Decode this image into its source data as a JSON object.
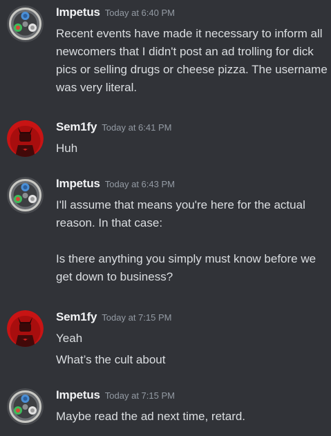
{
  "messages": [
    {
      "author": "Impetus",
      "avatar_icon": "compass-emblem-avatar",
      "timestamp": "Today at 6:40 PM",
      "lines": [
        "Recent events have made it necessary to inform all newcomers that I didn't post an ad trolling for dick pics or selling drugs or cheese pizza. The username was very literal."
      ]
    },
    {
      "author": "Sem1fy",
      "avatar_icon": "batman-red-avatar",
      "timestamp": "Today at 6:41 PM",
      "lines": [
        "Huh"
      ]
    },
    {
      "author": "Impetus",
      "avatar_icon": "compass-emblem-avatar",
      "timestamp": "Today at 6:43 PM",
      "lines": [
        "I'll assume that means you're here for the actual reason. In that case:\n\nIs there anything you simply must know before we get down to business?"
      ]
    },
    {
      "author": "Sem1fy",
      "avatar_icon": "batman-red-avatar",
      "timestamp": "Today at 7:15 PM",
      "lines": [
        "Yeah",
        "What’s the cult about"
      ]
    },
    {
      "author": "Impetus",
      "avatar_icon": "compass-emblem-avatar",
      "timestamp": "Today at 7:15 PM",
      "lines": [
        "Maybe read the ad next time, retard."
      ]
    }
  ],
  "colors": {
    "background": "#313338",
    "username": "#f2f3f5",
    "timestamp": "#949ba4",
    "text": "#dbdee1"
  }
}
